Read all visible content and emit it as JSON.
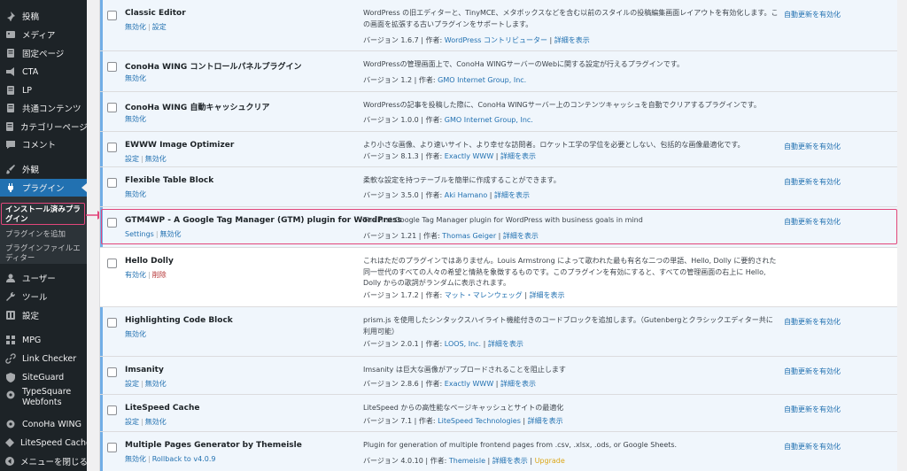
{
  "sidebar": {
    "items": [
      {
        "label": "投稿",
        "icon": "pin-icon"
      },
      {
        "label": "メディア",
        "icon": "media-icon"
      },
      {
        "label": "固定ページ",
        "icon": "page-icon"
      },
      {
        "label": "CTA",
        "icon": "megaphone-icon"
      },
      {
        "label": "LP",
        "icon": "page-icon"
      },
      {
        "label": "共通コンテンツ",
        "icon": "page-icon"
      },
      {
        "label": "カテゴリーページ",
        "icon": "page-icon"
      },
      {
        "label": "コメント",
        "icon": "comment-icon"
      },
      {
        "label": "外観",
        "icon": "brush-icon"
      },
      {
        "label": "プラグイン",
        "icon": "plugin-icon"
      },
      {
        "label": "ユーザー",
        "icon": "user-icon"
      },
      {
        "label": "ツール",
        "icon": "wrench-icon"
      },
      {
        "label": "設定",
        "icon": "settings-icon"
      },
      {
        "label": "MPG",
        "icon": "grid-icon"
      },
      {
        "label": "Link Checker",
        "icon": "link-icon"
      },
      {
        "label": "SiteGuard",
        "icon": "shield-icon"
      },
      {
        "label": "TypeSquare Webfonts",
        "icon": "gear-icon"
      },
      {
        "label": "ConoHa WING",
        "icon": "gear-icon"
      },
      {
        "label": "LiteSpeed Cache",
        "icon": "diamond-icon"
      },
      {
        "label": "メニューを閉じる",
        "icon": "collapse-icon"
      }
    ],
    "submenu": [
      {
        "label": "インストール済みプラグイン"
      },
      {
        "label": "プラグインを追加"
      },
      {
        "label": "プラグインファイルエディター"
      }
    ]
  },
  "plugins": [
    {
      "name": "Classic Editor",
      "actions": [
        "無効化",
        "設定"
      ],
      "description": "WordPress の旧エディターと、TinyMCE、メタボックスなどを含む以前のスタイルの投稿編集画面レイアウトを有効化します。この画面を拡張する古いプラグインをサポートします。",
      "version": "バージョン 1.6.7",
      "author_label": "作者:",
      "author": "WordPress コントリビューター",
      "details": "詳細を表示",
      "auto_update": "自動更新を有効化",
      "active": true
    },
    {
      "name": "ConoHa WING コントロールパネルプラグイン",
      "actions": [
        "無効化"
      ],
      "description": "WordPressの管理画面上で、ConoHa WINGサーバーのWebに関する設定が行えるプラグインです。",
      "version": "バージョン 1.2",
      "author_label": "作者:",
      "author": "GMO Internet Group, Inc.",
      "details": "",
      "auto_update": "",
      "active": true
    },
    {
      "name": "ConoHa WING 自動キャッシュクリア",
      "actions": [
        "無効化"
      ],
      "description": "WordPressの記事を投稿した際に、ConoHa WINGサーバー上のコンテンツキャッシュを自動でクリアするプラグインです。",
      "version": "バージョン 1.0.0",
      "author_label": "作者:",
      "author": "GMO Internet Group, Inc.",
      "details": "",
      "auto_update": "",
      "active": true
    },
    {
      "name": "EWWW Image Optimizer",
      "actions": [
        "設定",
        "無効化"
      ],
      "description": "より小さな画像、より速いサイト、より幸せな訪問者。ロケット工学の学位を必要としない、包括的な画像最適化です。",
      "version": "バージョン 8.1.3",
      "author_label": "作者:",
      "author": "Exactly WWW",
      "details": "詳細を表示",
      "auto_update": "自動更新を有効化",
      "active": true
    },
    {
      "name": "Flexible Table Block",
      "actions": [
        "無効化"
      ],
      "description": "柔軟な設定を持つテーブルを簡単に作成することができます。",
      "version": "バージョン 3.5.0",
      "author_label": "作者:",
      "author": "Aki Hamano",
      "details": "詳細を表示",
      "auto_update": "自動更新を有効化",
      "active": true
    },
    {
      "name": "GTM4WP - A Google Tag Manager (GTM) plugin for WordPress",
      "actions": [
        "Settings",
        "無効化"
      ],
      "description": "The first Google Tag Manager plugin for WordPress with business goals in mind",
      "version": "バージョン 1.21",
      "author_label": "作者:",
      "author": "Thomas Geiger",
      "details": "詳細を表示",
      "auto_update": "自動更新を有効化",
      "active": true
    },
    {
      "name": "Hello Dolly",
      "actions": [
        "有効化",
        "削除"
      ],
      "description": "これはただのプラグインではありません。Louis Armstrong によって歌われた最も有名な二つの単語、Hello, Dolly に要約された同一世代のすべての人々の希望と情熱を象徴するものです。このプラグインを有効にすると、すべての管理画面の右上に Hello, Dolly からの歌詞がランダムに表示されます。",
      "version": "バージョン 1.7.2",
      "author_label": "作者:",
      "author": "マット・マレンウェッグ",
      "details": "詳細を表示",
      "auto_update": "",
      "active": false
    },
    {
      "name": "Highlighting Code Block",
      "actions": [
        "無効化"
      ],
      "description": "prism.js を使用したシンタックスハイライト機能付きのコードブロックを追加します。（Gutenbergとクラシックエディター共に利用可能）",
      "version": "バージョン 2.0.1",
      "author_label": "作者:",
      "author": "LOOS, Inc.",
      "details": "詳細を表示",
      "auto_update": "自動更新を有効化",
      "active": true
    },
    {
      "name": "Imsanity",
      "actions": [
        "設定",
        "無効化"
      ],
      "description": "Imsanity は巨大な画像がアップロードされることを阻止します",
      "version": "バージョン 2.8.6",
      "author_label": "作者:",
      "author": "Exactly WWW",
      "details": "詳細を表示",
      "auto_update": "自動更新を有効化",
      "active": true
    },
    {
      "name": "LiteSpeed Cache",
      "actions": [
        "設定",
        "無効化"
      ],
      "description": "LiteSpeed からの高性能なページキャッシュとサイトの最適化",
      "version": "バージョン 7.1",
      "author_label": "作者:",
      "author": "LiteSpeed Technologies",
      "details": "詳細を表示",
      "auto_update": "自動更新を有効化",
      "active": true
    },
    {
      "name": "Multiple Pages Generator by Themeisle",
      "actions": [
        "無効化",
        "Rollback to v4.0.9"
      ],
      "description": "Plugin for generation of multiple frontend pages from .csv, .xlsx, .ods, or Google Sheets.",
      "version": "バージョン 4.0.10",
      "author_label": "作者:",
      "author": "Themeisle",
      "details": "詳細を表示",
      "upgrade": "Upgrade",
      "auto_update": "自動更新を有効化",
      "active": true
    }
  ]
}
